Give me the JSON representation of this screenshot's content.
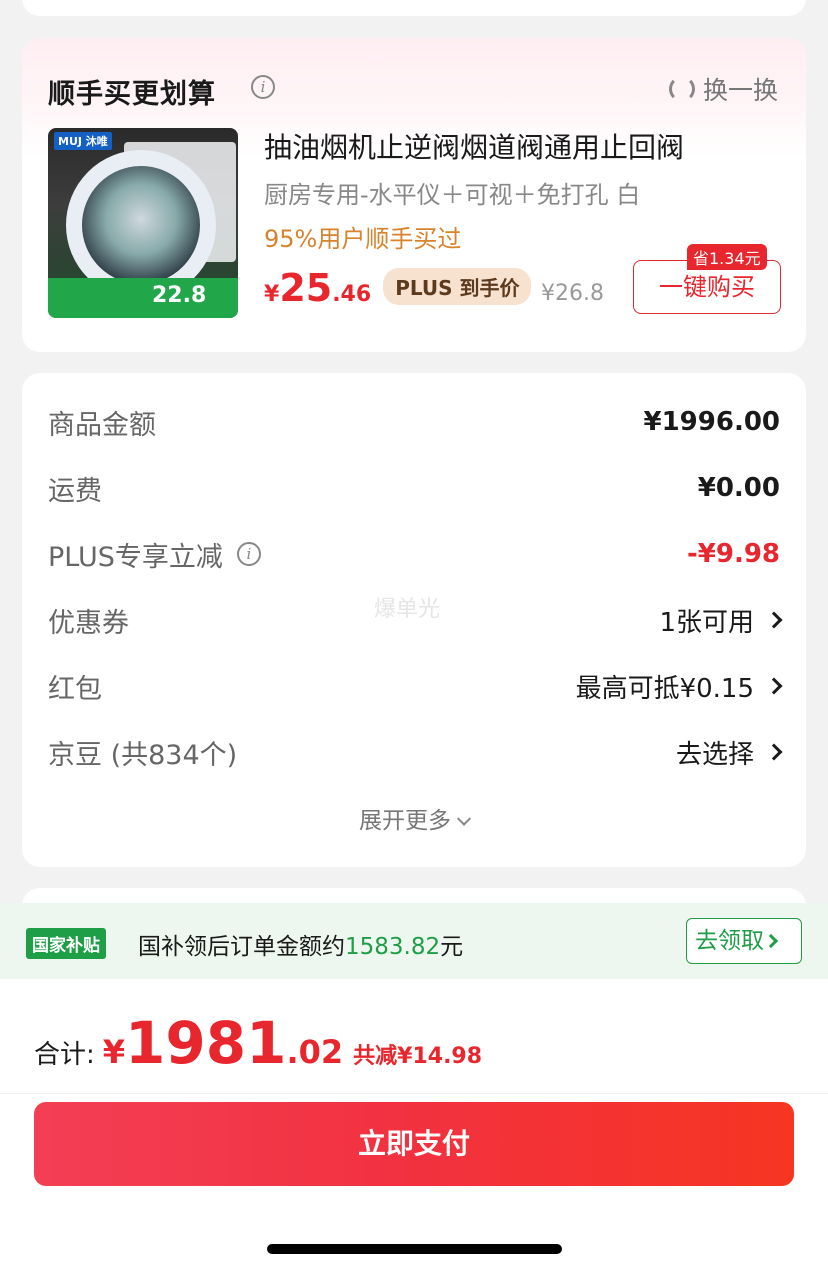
{
  "recommend": {
    "title": "顺手买更划算",
    "swap_label": "换一换",
    "product": {
      "name": "抽油烟机止逆阀烟道阀通用止回阀",
      "spec": "厨房专用-水平仪＋可视＋免打孔 白",
      "social_proof": "95%用户顺手买过",
      "price_yen": "¥",
      "price_int": "25",
      "price_dec": ".46",
      "plus_tag": "PLUS 到手价",
      "original_price": "¥26.8",
      "save_badge": "省1.34元",
      "buy_label": "一键购买",
      "image_brand": "MUJ 沐唯",
      "image_subsidy_price": "22.8"
    }
  },
  "summary": {
    "rows": [
      {
        "label": "商品金额",
        "value": "¥1996.00"
      },
      {
        "label": "运费",
        "value": "¥0.00"
      },
      {
        "label": "PLUS专享立减",
        "value": "-¥9.98"
      },
      {
        "label": "优惠券",
        "value": "1张可用"
      },
      {
        "label": "红包",
        "value": "最高可抵¥0.15"
      },
      {
        "label": "京豆 (共834个)",
        "value": "去选择"
      }
    ],
    "watermark": "爆单光",
    "expand_label": "展开更多"
  },
  "subsidy": {
    "tag": "国家补贴",
    "text_prefix": "国补领后订单金额约",
    "amount": "1583.82",
    "text_suffix": "元",
    "claim_label": "去领取"
  },
  "footer": {
    "total_label": "合计:",
    "total_yen": "¥",
    "total_int": "1981",
    "total_dec": ".02",
    "total_saved": "共减¥14.98",
    "pay_label": "立即支付"
  },
  "colors": {
    "accent_red": "#e8262e",
    "subsidy_green": "#1e9e46",
    "plus_orange": "#d8822c"
  }
}
